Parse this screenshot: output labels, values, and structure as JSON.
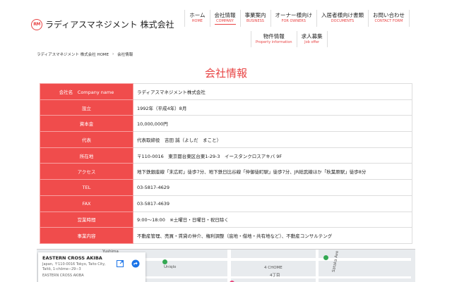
{
  "header": {
    "logo_mark": "RM",
    "company_name": "ラディアスマネジメント 株式会社",
    "nav_row1": [
      {
        "jp": "ホーム",
        "en": "HOME",
        "active": false
      },
      {
        "jp": "会社情報",
        "en": "COMPANY",
        "active": true
      },
      {
        "jp": "事業案内",
        "en": "BUSINESS",
        "active": false
      },
      {
        "jp": "オーナー様向け",
        "en": "FOR OWNERS",
        "active": false
      },
      {
        "jp": "入居者様向け書類",
        "en": "DOCUMENTS",
        "active": false
      },
      {
        "jp": "お問い合わせ",
        "en": "CONTACT FORM",
        "active": false
      }
    ],
    "nav_row2": [
      {
        "jp": "物件情報",
        "en": "Property information"
      },
      {
        "jp": "求人募集",
        "en": "Job offer"
      }
    ]
  },
  "breadcrumb": {
    "home": "ラディアスマネジメント 株式会社 HOME",
    "sep": "›",
    "current": "会社情報"
  },
  "page_title": "会社情報",
  "company_table": [
    {
      "key": "会社名　Company name",
      "value": "ラディアスマネジメント株式会社"
    },
    {
      "key": "設立",
      "value": "1992年（平成4年）8月"
    },
    {
      "key": "資本金",
      "value": "10,000,000円"
    },
    {
      "key": "代表",
      "value": "代表取締役　吉田 誠（よしだ　まこと）"
    },
    {
      "key": "所在地",
      "value": "〒110-0016　東京都台東区台東1-29-3　イースタンクロスアキバ 9F"
    },
    {
      "key": "アクセス",
      "value": "地下鉄銀座線「末広町」徒歩7分、地下鉄日比谷線「仲御徒町駅」徒歩7分、JR総武線ほか「秋葉原駅」徒歩8分"
    },
    {
      "key": "TEL",
      "value": "03-5817-4629"
    },
    {
      "key": "FAX",
      "value": "03-5817-4639"
    },
    {
      "key": "営業時間",
      "value": "9:00～18:00　※土曜日・日曜日・祝日除く"
    },
    {
      "key": "事業内容",
      "value": "不動産管理、売買・賃貸の仲介、権利調整（底地・借地・共有地など）、不動産コンサルテング"
    }
  ],
  "map": {
    "place_name": "EASTERN CROSS AKIBA",
    "address": "Japan, 〒110-0016 Tokyo, Taito City, Taitō, 1-chōme−29−3",
    "address_short": "EASTERN CROSS AKIBA",
    "labels": {
      "yushima": "Yushima",
      "uniqlo": "Uniqlo",
      "chome4": "4 CHOME",
      "block4": "4丁目",
      "shotengai": "Sataka Ave"
    },
    "colors": {
      "pin_green": "#34a853",
      "pin_pink": "#e8467c"
    }
  }
}
